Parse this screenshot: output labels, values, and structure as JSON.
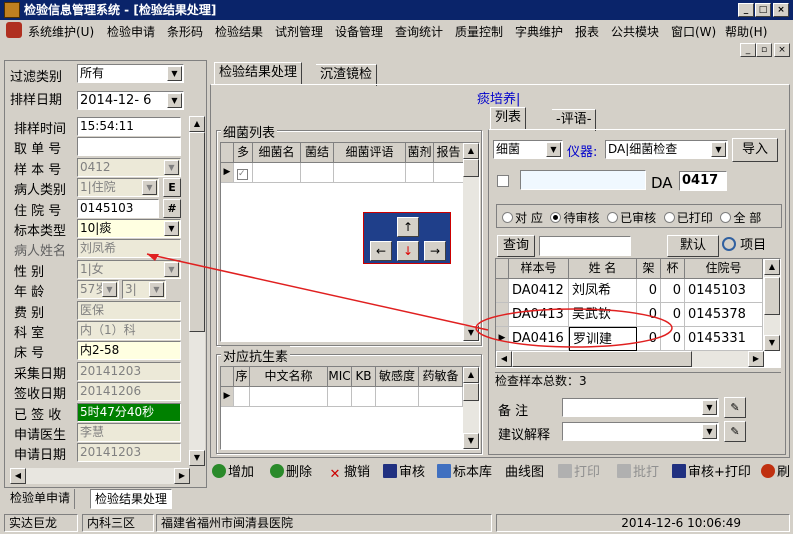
{
  "window": {
    "title": "检验信息管理系统 - [检验结果处理]"
  },
  "menu": [
    "系统维护(U)",
    "检验申请",
    "条形码",
    "检验结果",
    "试剂管理",
    "设备管理",
    "查询统计",
    "质量控制",
    "字典维护",
    "报表",
    "公共模块",
    "窗口(W)",
    "帮助(H)"
  ],
  "left": {
    "filter_label": "过滤类别",
    "filter_value": "所有",
    "date_label": "排样日期",
    "date_value": "2014-12- 6",
    "rows": [
      {
        "label": "排样时间",
        "value": "15:54:11"
      },
      {
        "label": "取 单 号",
        "value": ""
      },
      {
        "label": "样 本 号",
        "value": "0412"
      },
      {
        "label": "病人类别",
        "value": "1|住院",
        "btn": "E"
      },
      {
        "label": "住 院 号",
        "value": "0145103",
        "btn": "#"
      },
      {
        "label": "标本类型",
        "value": "10|痰"
      },
      {
        "label": "病人姓名",
        "value": "刘凤希"
      },
      {
        "label": "性    别",
        "value": "1|女"
      },
      {
        "label": "年    龄",
        "value": "57岁",
        "value2": "3|"
      },
      {
        "label": "费    别",
        "value": "医保"
      },
      {
        "label": "科    室",
        "value": "内（1）科"
      },
      {
        "label": "床    号",
        "value": "内2-58"
      },
      {
        "label": "采集日期",
        "value": "20141203"
      },
      {
        "label": "签收日期",
        "value": "20141206"
      },
      {
        "label": "已 签 收",
        "value": "5时47分40秒"
      },
      {
        "label": "申请医生",
        "value": "李慧"
      },
      {
        "label": "申请日期",
        "value": "20141203"
      }
    ]
  },
  "tabs": [
    "检验结果处理",
    "沉渣镜检"
  ],
  "culture_label": "痰培养|",
  "bact": {
    "title": "细菌列表",
    "headers": [
      "多",
      "细菌名",
      "菌结",
      "细菌评语",
      "菌剂",
      "报告"
    ]
  },
  "antibiotic": {
    "title": "对应抗生素",
    "headers": [
      "序",
      "中文名称",
      "MIC",
      "KB",
      "敏感度",
      "药敏备"
    ]
  },
  "right": {
    "tabs": [
      "列表",
      "-评语-"
    ],
    "type_value": "细菌",
    "instrument_label": "仪器:",
    "instrument_value": "DA|细菌检查",
    "import_btn": "导入",
    "da_label": "DA",
    "da_value": "0417",
    "radios": [
      "对 应",
      "待审核",
      "已审核",
      "已打印",
      "全 部"
    ],
    "radio_selected": 1,
    "query_btn": "查询",
    "default_btn": "默认",
    "items_btn": "项目",
    "grid_headers": [
      "样本号",
      "姓 名",
      "架",
      "杯",
      "住院号"
    ],
    "grid_rows": [
      {
        "sample": "DA0412",
        "name": "刘凤希",
        "rack": "0",
        "cup": "0",
        "inpatient": "0145103"
      },
      {
        "sample": "DA0413",
        "name": "吴武钦",
        "rack": "0",
        "cup": "0",
        "inpatient": "0145378"
      },
      {
        "sample": "DA0416",
        "name": "罗训建",
        "rack": "0",
        "cup": "0",
        "inpatient": "0145331"
      }
    ],
    "total_label": "检查样本总数：3",
    "note_label": "备    注",
    "advice_label": "建议解释"
  },
  "toolbar": [
    "增加",
    "删除",
    "撤销",
    "审核",
    "标本库",
    "曲线图",
    "打印",
    "批打",
    "审核+打印",
    "刷"
  ],
  "bottom_tabs": [
    "检验单申请",
    "检验结果处理"
  ],
  "status": {
    "user": "实达巨龙",
    "dept": "内科三区",
    "org": "福建省福州市闽清县医院",
    "time": "2014-12-6  10:06:49"
  },
  "colors": {
    "title_bar": "#0a246a",
    "accent_blue": "#0000cc",
    "selection": "#000080",
    "annotation_red": "#e02020"
  }
}
